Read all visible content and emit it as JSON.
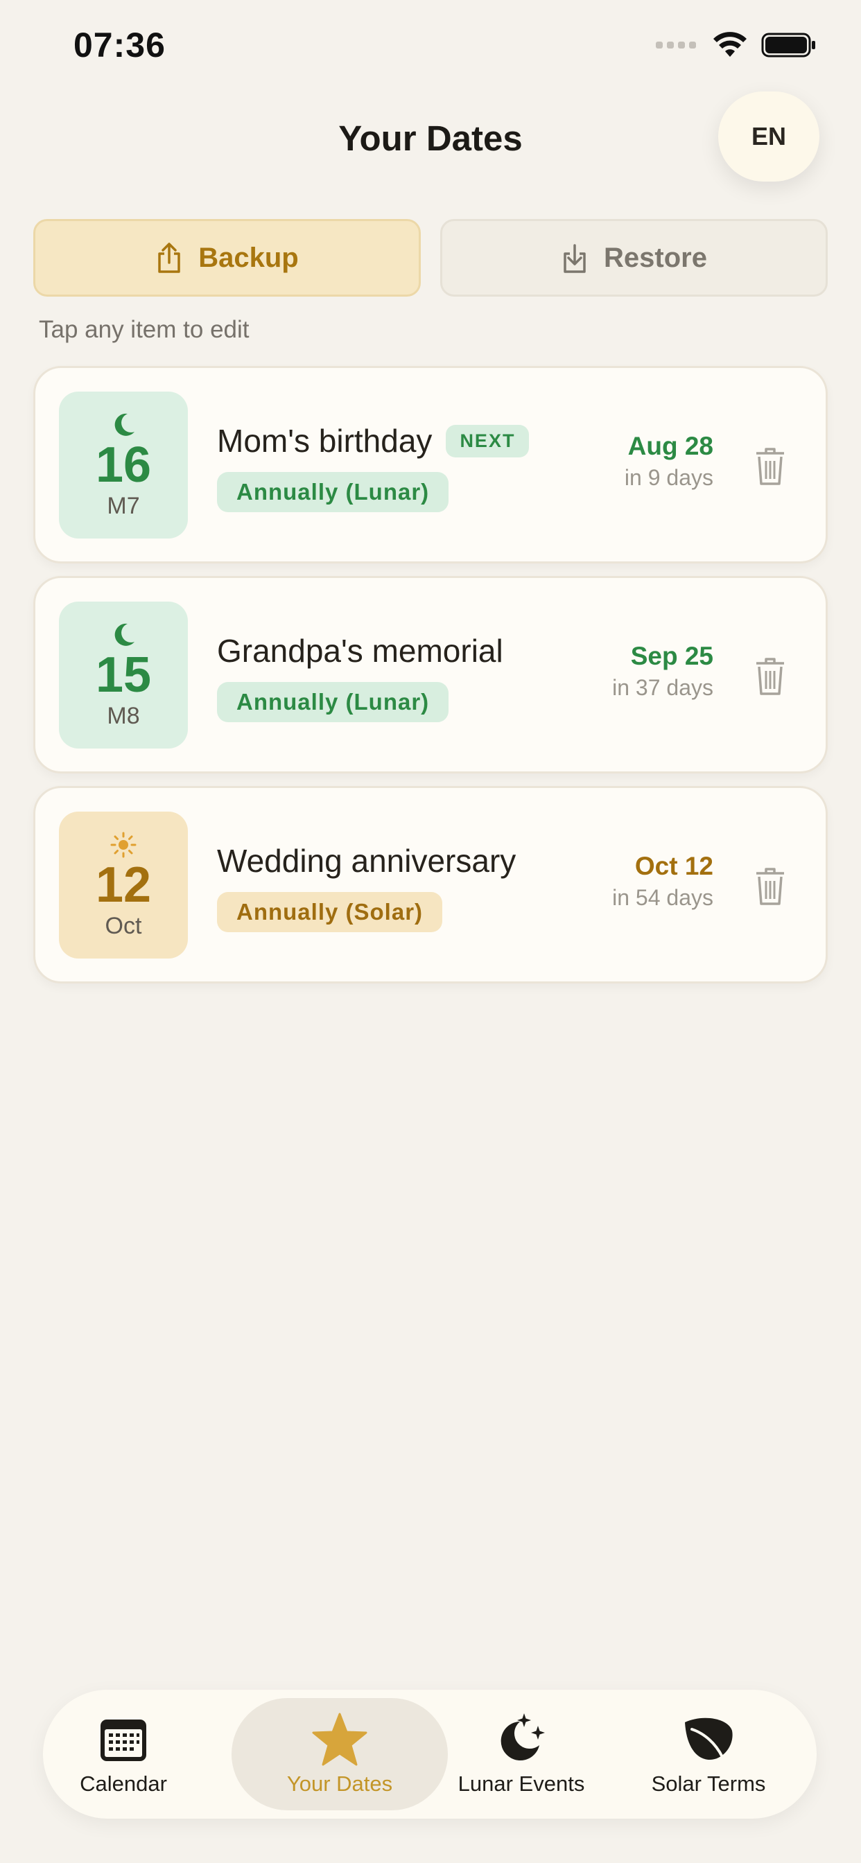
{
  "status_bar": {
    "time": "07:36"
  },
  "header": {
    "title": "Your Dates",
    "language_button": "EN"
  },
  "actions": {
    "backup_label": "Backup",
    "restore_label": "Restore"
  },
  "hint": "Tap any item to edit",
  "dates": [
    {
      "title": "Mom's birthday",
      "badge": "NEXT",
      "calendar": "lunar",
      "tile_icon": "moon-icon",
      "day": "16",
      "month": "M7",
      "recurrence": "Annually (Lunar)",
      "next_date": "Aug 28",
      "relative": "in 9 days",
      "accent": "#2c8a44"
    },
    {
      "title": "Grandpa's memorial",
      "calendar": "lunar",
      "tile_icon": "moon-icon",
      "day": "15",
      "month": "M8",
      "recurrence": "Annually (Lunar)",
      "next_date": "Sep 25",
      "relative": "in 37 days",
      "accent": "#2c8a44"
    },
    {
      "title": "Wedding anniversary",
      "calendar": "solar",
      "tile_icon": "sun-icon",
      "day": "12",
      "month": "Oct",
      "recurrence": "Annually (Solar)",
      "next_date": "Oct 12",
      "relative": "in 54 days",
      "accent": "#a3700f"
    }
  ],
  "tabs": [
    {
      "label": "Calendar",
      "icon": "calendar-icon",
      "active": false
    },
    {
      "label": "Your Dates",
      "icon": "star-icon",
      "active": true
    },
    {
      "label": "Lunar Events",
      "icon": "moon-stars-icon",
      "active": false
    },
    {
      "label": "Solar Terms",
      "icon": "leaf-icon",
      "active": false
    }
  ],
  "colors": {
    "background": "#f5f2ec",
    "lunar_accent": "#2c8a44",
    "solar_accent": "#a3700f",
    "active_tab": "#c39528"
  }
}
